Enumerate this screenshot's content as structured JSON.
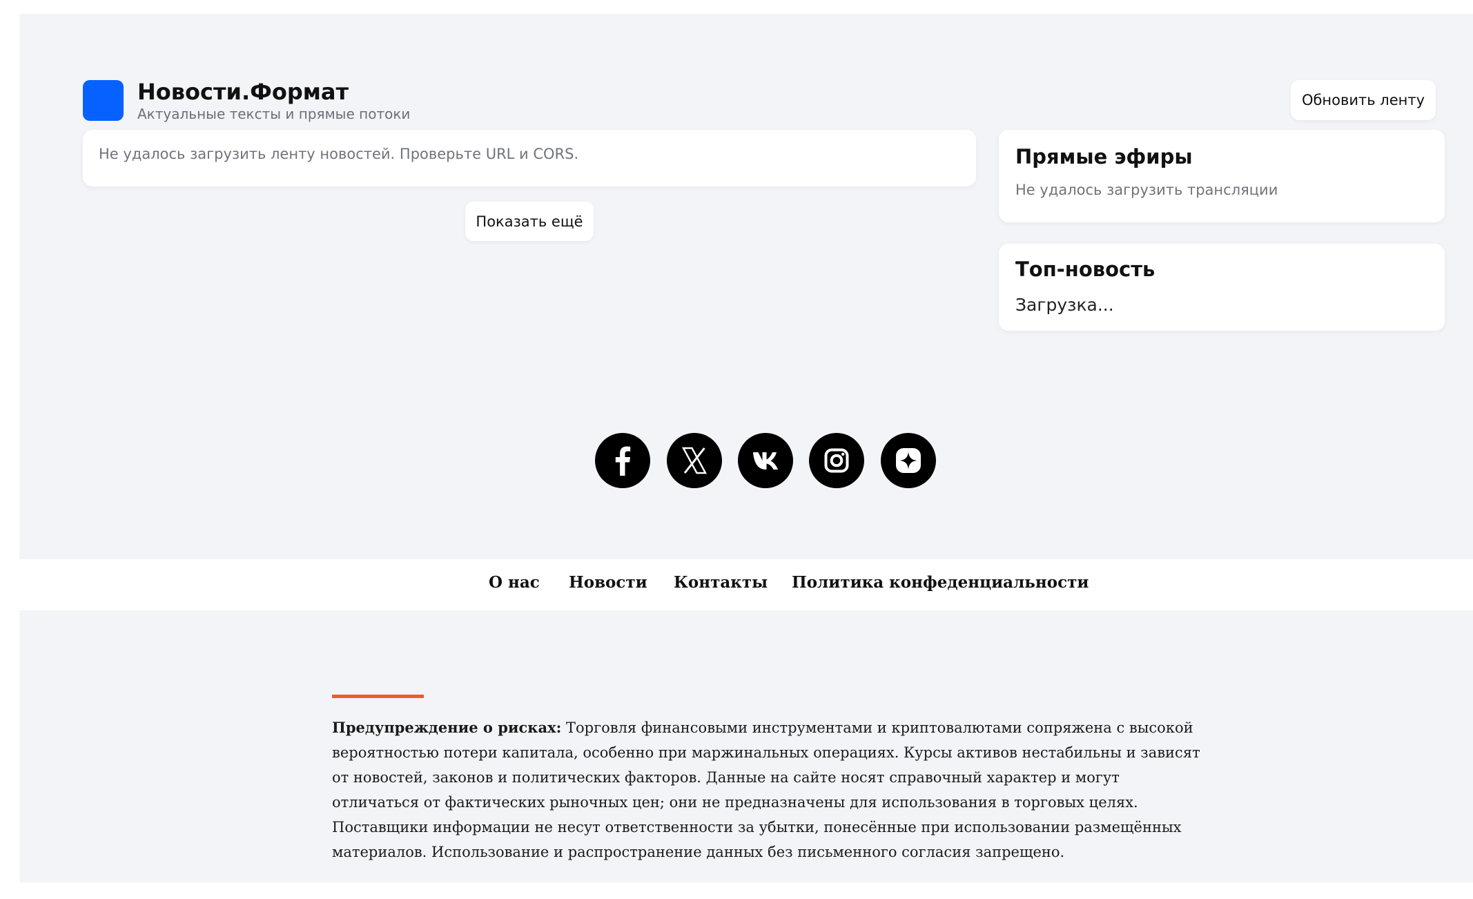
{
  "header": {
    "title": "Новости.Формат",
    "subtitle": "Актуальные тексты и прямые потоки",
    "refresh_label": "Обновить ленту",
    "logo_color": "#0661ff"
  },
  "feed": {
    "error_text": "Не удалось загрузить ленту новостей. Проверьте URL и CORS.",
    "show_more_label": "Показать ещё"
  },
  "sidebar": {
    "live": {
      "title": "Прямые эфиры",
      "status": "Не удалось загрузить трансляции"
    },
    "top_news": {
      "title": "Топ-новость",
      "status": "Загрузка..."
    }
  },
  "social": {
    "icons": [
      "facebook-icon",
      "x-icon",
      "vk-icon",
      "instagram-icon",
      "dzen-icon"
    ]
  },
  "footer_nav": {
    "about": "О нас",
    "news": "Новости",
    "contacts": "Контакты",
    "privacy": "Политика конфеденциальности"
  },
  "disclaimer": {
    "label": "Предупреждение о рисках:",
    "text": "Торговля финансовыми инструментами и криптовалютами сопряжена с высокой вероятностью потери капитала, особенно при маржинальных операциях. Курсы активов нестабильны и зависят от новостей, законов и политических факторов. Данные на сайте носят справочный характер и могут отличаться от фактических рыночных цен; они не предназначены для использования в торговых целях. Поставщики информации не несут ответственности за убытки, понесённые при использовании размещённых материалов. Использование и распространение данных без письменного согласия запрещено.",
    "accent_color": "#ef5a29"
  }
}
